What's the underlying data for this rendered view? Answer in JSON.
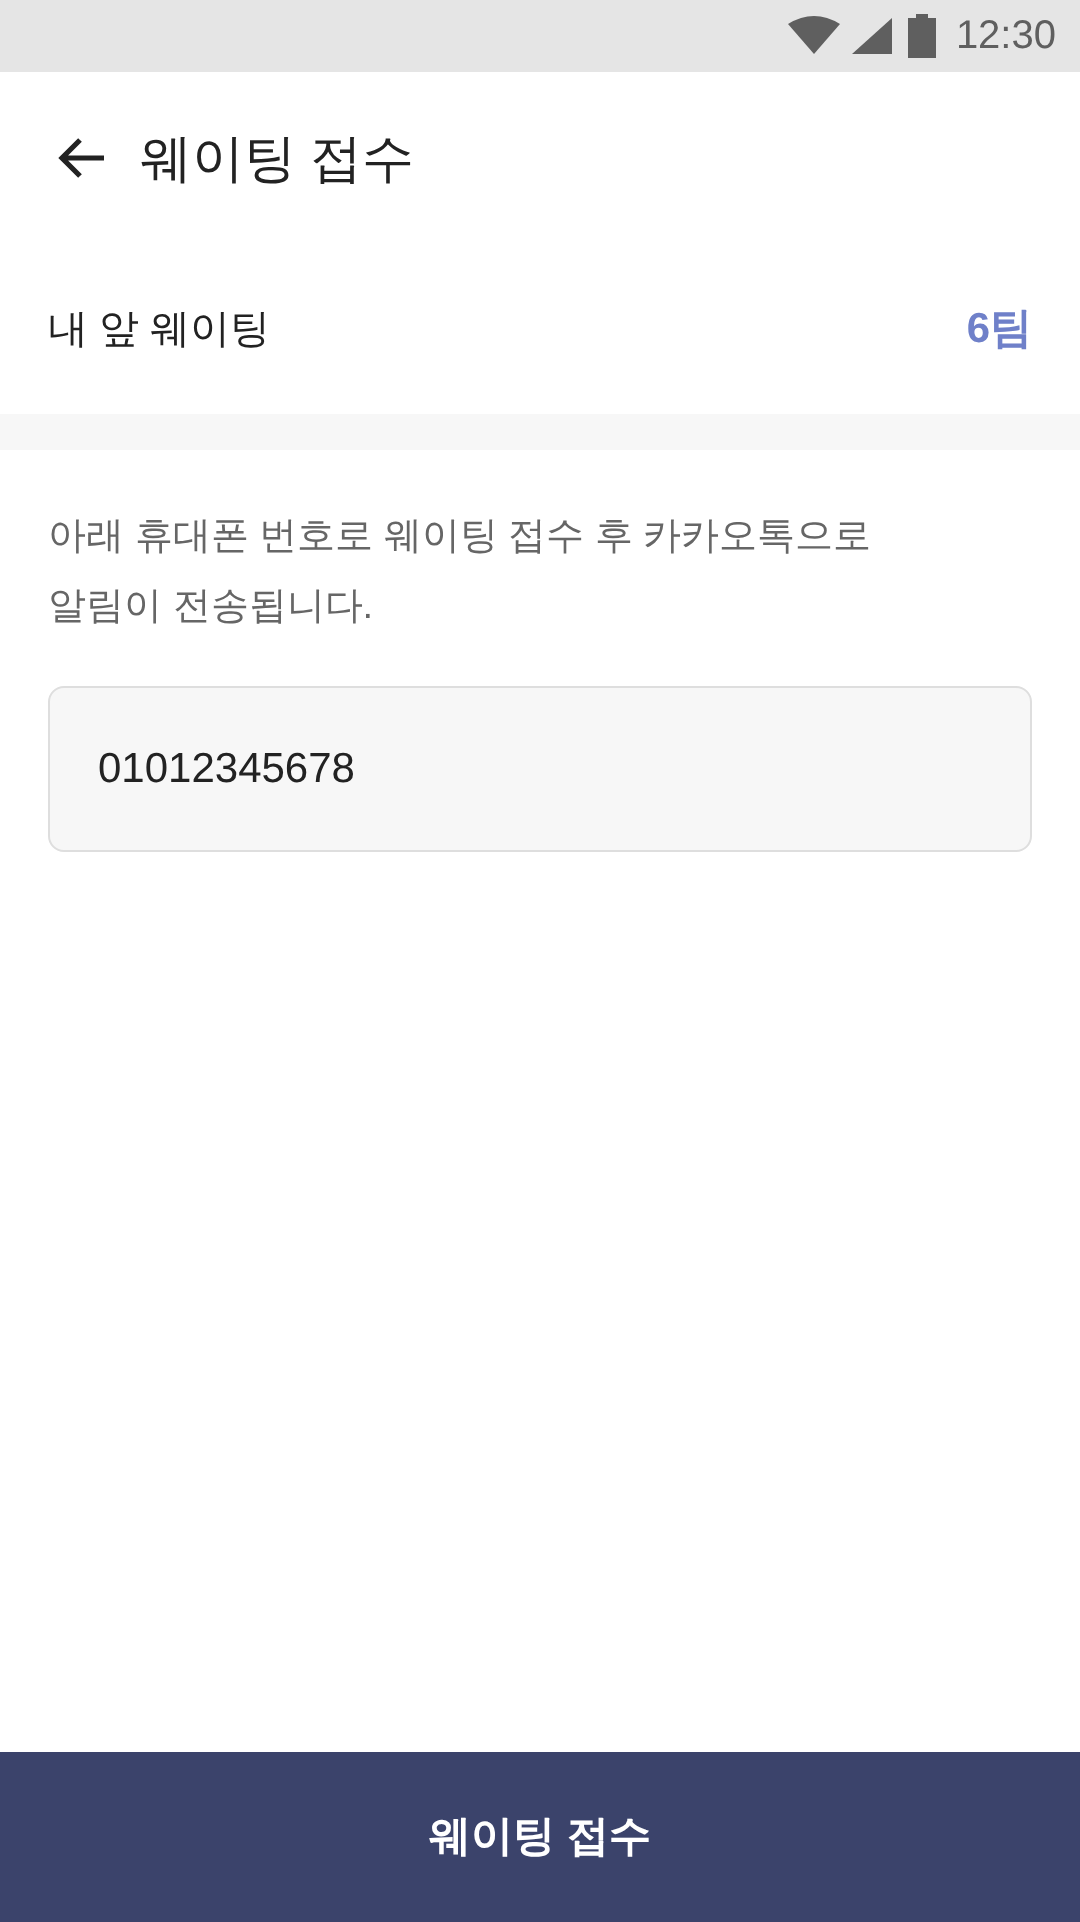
{
  "status_bar": {
    "time": "12:30"
  },
  "app_bar": {
    "title": "웨이팅 접수"
  },
  "queue": {
    "label": "내 앞 웨이팅",
    "value": "6팀"
  },
  "notice": "아래 휴대폰 번호로 웨이팅 접수 후 카카오톡으로 알림이 전송됩니다.",
  "phone_field": {
    "value": "01012345678"
  },
  "submit_button": {
    "label": "웨이팅 접수"
  }
}
